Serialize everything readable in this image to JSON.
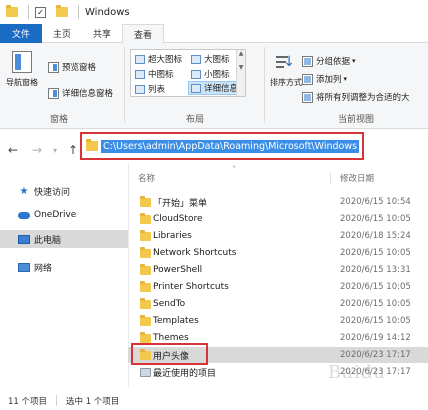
{
  "window": {
    "title": "Windows"
  },
  "ribbon_tabs": [
    "文件",
    "主页",
    "共享",
    "查看"
  ],
  "ribbon": {
    "panes": {
      "nav_pane": "导航窗格",
      "preview": "预览窗格",
      "details_pane": "详细信息窗格",
      "group_label": "窗格"
    },
    "layout": {
      "items": [
        "超大图标",
        "大图标",
        "中图标",
        "小图标",
        "列表",
        "详细信息"
      ],
      "selected": "详细信息",
      "group_label": "布局"
    },
    "current_view": {
      "sort": "排序方式",
      "group_by": "分组依据",
      "add_columns": "添加列",
      "fit_columns": "将所有列调整为合适的大",
      "group_label": "当前视图"
    }
  },
  "address": {
    "path": "C:\\Users\\admin\\AppData\\Roaming\\Microsoft\\Windows"
  },
  "nav_pane": {
    "items": [
      {
        "label": "快速访问",
        "icon": "star-icon"
      },
      {
        "label": "OneDrive",
        "icon": "cloud-icon"
      },
      {
        "label": "此电脑",
        "icon": "computer-icon"
      },
      {
        "label": "网络",
        "icon": "network-icon"
      }
    ],
    "selected": "此电脑"
  },
  "file_list": {
    "columns": [
      "名称",
      "修改日期"
    ],
    "rows": [
      {
        "name": "「开始」菜单",
        "date": "2020/6/15 10:54"
      },
      {
        "name": "CloudStore",
        "date": "2020/6/15 10:05"
      },
      {
        "name": "Libraries",
        "date": "2020/6/18 15:24"
      },
      {
        "name": "Network Shortcuts",
        "date": "2020/6/15 10:05"
      },
      {
        "name": "PowerShell",
        "date": "2020/6/15 13:31"
      },
      {
        "name": "Printer Shortcuts",
        "date": "2020/6/15 10:05"
      },
      {
        "name": "SendTo",
        "date": "2020/6/15 10:05"
      },
      {
        "name": "Templates",
        "date": "2020/6/15 10:05"
      },
      {
        "name": "Themes",
        "date": "2020/6/19 14:12"
      },
      {
        "name": "用户头像",
        "date": "2020/6/23 17:17"
      },
      {
        "name": "最近使用的项目",
        "date": "2020/6/23 17:17"
      }
    ],
    "selected": "用户头像"
  },
  "status": {
    "count": "11 个项目",
    "selected": "选中 1 个项目"
  },
  "watermark": "Baidu",
  "colors": {
    "accent": "#1a6bc4",
    "highlight": "#d9333a",
    "folder": "#f3c94d",
    "selection": "#3a8ee6"
  }
}
